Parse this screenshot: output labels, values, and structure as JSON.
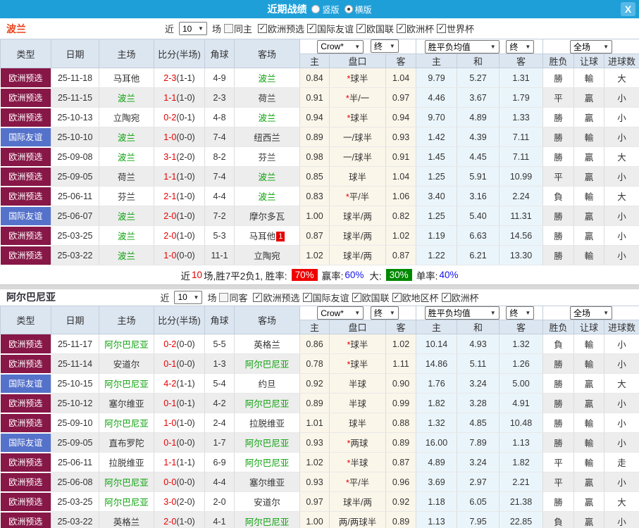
{
  "titlebar": {
    "title": "近期战绩",
    "vertical_label": "竖版",
    "horizontal_label": "横版",
    "horizontal_checked": true,
    "close_label": "X"
  },
  "colors": {
    "titlebar_blue": "#1f9fd8",
    "qualifier_maroon": "#871747",
    "friendly_blue": "#5572cb",
    "team_link_green": "#0aa10a",
    "score_red": "#e60000",
    "win_rate_badge_red": "#ee0000",
    "big_rate_badge_green": "#008800",
    "handicap_col_cream": "#fbf6ea",
    "avg_col_blue": "#eaf5fb"
  },
  "table_header": {
    "type": "类型",
    "date": "日期",
    "home": "主场",
    "score": "比分(半场)",
    "corner": "角球",
    "away": "客场",
    "odds_select": "Crow*",
    "odds_final": "终",
    "odds_home": "主",
    "odds_handicap": "盘口",
    "odds_away": "客",
    "avg_select": "胜平负均值",
    "avg_final": "终",
    "avg_home": "主",
    "avg_draw": "和",
    "avg_away": "客",
    "full_select": "全场",
    "res_col": "胜负",
    "let_col": "让球",
    "goal_col": "进球数"
  },
  "sections": [
    {
      "team": "波兰",
      "near_label": "近",
      "count": "10",
      "unit_label": "场",
      "same_label": "同主",
      "same_checked": false,
      "filters": [
        {
          "label": "欧洲预选",
          "checked": true
        },
        {
          "label": "国际友谊",
          "checked": true
        },
        {
          "label": "欧国联",
          "checked": true
        },
        {
          "label": "欧洲杯",
          "checked": true
        },
        {
          "label": "世界杯",
          "checked": true
        }
      ],
      "rows": [
        {
          "comp": "欧洲预选",
          "friendly": false,
          "date": "25-11-18",
          "home": "马耳他",
          "homeActive": false,
          "homeBadge": "",
          "score": "2-3",
          "half": "(1-1)",
          "corner": "4-9",
          "away": "波兰",
          "awayActive": true,
          "awayBadge": "",
          "h": "0.84",
          "star": true,
          "hc": "球半",
          "a": "1.04",
          "m1": "9.79",
          "m2": "5.27",
          "m3": "1.31",
          "r": "勝",
          "hr": "輸",
          "g": "大"
        },
        {
          "comp": "欧洲预选",
          "friendly": false,
          "date": "25-11-15",
          "home": "波兰",
          "homeActive": true,
          "homeBadge": "",
          "score": "1-1",
          "half": "(1-0)",
          "corner": "2-3",
          "away": "荷兰",
          "awayActive": false,
          "awayBadge": "",
          "h": "0.91",
          "star": true,
          "hc": "半/一",
          "a": "0.97",
          "m1": "4.46",
          "m2": "3.67",
          "m3": "1.79",
          "r": "平",
          "hr": "贏",
          "g": "小"
        },
        {
          "comp": "欧洲预选",
          "friendly": false,
          "date": "25-10-13",
          "home": "立陶宛",
          "homeActive": false,
          "homeBadge": "",
          "score": "0-2",
          "half": "(0-1)",
          "corner": "4-8",
          "away": "波兰",
          "awayActive": true,
          "awayBadge": "",
          "h": "0.94",
          "star": true,
          "hc": "球半",
          "a": "0.94",
          "m1": "9.70",
          "m2": "4.89",
          "m3": "1.33",
          "r": "勝",
          "hr": "贏",
          "g": "小"
        },
        {
          "comp": "国际友谊",
          "friendly": true,
          "date": "25-10-10",
          "home": "波兰",
          "homeActive": true,
          "homeBadge": "",
          "score": "1-0",
          "half": "(0-0)",
          "corner": "7-4",
          "away": "纽西兰",
          "awayActive": false,
          "awayBadge": "",
          "h": "0.89",
          "star": false,
          "hc": "一/球半",
          "a": "0.93",
          "m1": "1.42",
          "m2": "4.39",
          "m3": "7.11",
          "r": "勝",
          "hr": "輸",
          "g": "小"
        },
        {
          "comp": "欧洲预选",
          "friendly": false,
          "date": "25-09-08",
          "home": "波兰",
          "homeActive": true,
          "homeBadge": "",
          "score": "3-1",
          "half": "(2-0)",
          "corner": "8-2",
          "away": "芬兰",
          "awayActive": false,
          "awayBadge": "",
          "h": "0.98",
          "star": false,
          "hc": "一/球半",
          "a": "0.91",
          "m1": "1.45",
          "m2": "4.45",
          "m3": "7.11",
          "r": "勝",
          "hr": "贏",
          "g": "大"
        },
        {
          "comp": "欧洲预选",
          "friendly": false,
          "date": "25-09-05",
          "home": "荷兰",
          "homeActive": false,
          "homeBadge": "",
          "score": "1-1",
          "half": "(1-0)",
          "corner": "7-4",
          "away": "波兰",
          "awayActive": true,
          "awayBadge": "",
          "h": "0.85",
          "star": false,
          "hc": "球半",
          "a": "1.04",
          "m1": "1.25",
          "m2": "5.91",
          "m3": "10.99",
          "r": "平",
          "hr": "贏",
          "g": "小"
        },
        {
          "comp": "欧洲预选",
          "friendly": false,
          "date": "25-06-11",
          "home": "芬兰",
          "homeActive": false,
          "homeBadge": "",
          "score": "2-1",
          "half": "(1-0)",
          "corner": "4-4",
          "away": "波兰",
          "awayActive": true,
          "awayBadge": "",
          "h": "0.83",
          "star": true,
          "hc": "平/半",
          "a": "1.06",
          "m1": "3.40",
          "m2": "3.16",
          "m3": "2.24",
          "r": "負",
          "hr": "輸",
          "g": "大"
        },
        {
          "comp": "国际友谊",
          "friendly": true,
          "date": "25-06-07",
          "home": "波兰",
          "homeActive": true,
          "homeBadge": "",
          "score": "2-0",
          "half": "(1-0)",
          "corner": "7-2",
          "away": "摩尔多瓦",
          "awayActive": false,
          "awayBadge": "",
          "h": "1.00",
          "star": false,
          "hc": "球半/两",
          "a": "0.82",
          "m1": "1.25",
          "m2": "5.40",
          "m3": "11.31",
          "r": "勝",
          "hr": "贏",
          "g": "小"
        },
        {
          "comp": "欧洲预选",
          "friendly": false,
          "date": "25-03-25",
          "home": "波兰",
          "homeActive": true,
          "homeBadge": "",
          "score": "2-0",
          "half": "(1-0)",
          "corner": "5-3",
          "away": "马耳他",
          "awayActive": false,
          "awayBadge": "1",
          "h": "0.87",
          "star": false,
          "hc": "球半/两",
          "a": "1.02",
          "m1": "1.19",
          "m2": "6.63",
          "m3": "14.56",
          "r": "勝",
          "hr": "贏",
          "g": "小"
        },
        {
          "comp": "欧洲预选",
          "friendly": false,
          "date": "25-03-22",
          "home": "波兰",
          "homeActive": true,
          "homeBadge": "",
          "score": "1-0",
          "half": "(0-0)",
          "corner": "11-1",
          "away": "立陶宛",
          "awayActive": false,
          "awayBadge": "",
          "h": "1.02",
          "star": false,
          "hc": "球半/两",
          "a": "0.87",
          "m1": "1.22",
          "m2": "6.21",
          "m3": "13.30",
          "r": "勝",
          "hr": "輸",
          "g": "小"
        }
      ],
      "summary": {
        "near": "近",
        "count": "10",
        "mid": "场,胜7平2负1, 胜率:",
        "win_pct": "70%",
        "win_odds_label": "赢率:",
        "win_odds_pct": "60%",
        "big_label": "大:",
        "big_pct": "30%",
        "single_label": "单率:",
        "single_pct": "40%"
      }
    },
    {
      "team": "阿尔巴尼亚",
      "near_label": "近",
      "count": "10",
      "unit_label": "场",
      "same_label": "同客",
      "same_checked": false,
      "filters": [
        {
          "label": "欧洲预选",
          "checked": true
        },
        {
          "label": "国际友谊",
          "checked": true
        },
        {
          "label": "欧国联",
          "checked": true
        },
        {
          "label": "欧地区杯",
          "checked": true
        },
        {
          "label": "欧洲杯",
          "checked": true
        }
      ],
      "rows": [
        {
          "comp": "欧洲预选",
          "friendly": false,
          "date": "25-11-17",
          "home": "阿尔巴尼亚",
          "homeActive": true,
          "homeBadge": "",
          "score": "0-2",
          "half": "(0-0)",
          "corner": "5-5",
          "away": "英格兰",
          "awayActive": false,
          "awayBadge": "",
          "h": "0.86",
          "star": true,
          "hc": "球半",
          "a": "1.02",
          "m1": "10.14",
          "m2": "4.93",
          "m3": "1.32",
          "r": "負",
          "hr": "輸",
          "g": "小"
        },
        {
          "comp": "欧洲预选",
          "friendly": false,
          "date": "25-11-14",
          "home": "安道尔",
          "homeActive": false,
          "homeBadge": "",
          "score": "0-1",
          "half": "(0-0)",
          "corner": "1-3",
          "away": "阿尔巴尼亚",
          "awayActive": true,
          "awayBadge": "",
          "h": "0.78",
          "star": true,
          "hc": "球半",
          "a": "1.11",
          "m1": "14.86",
          "m2": "5.11",
          "m3": "1.26",
          "r": "勝",
          "hr": "輸",
          "g": "小"
        },
        {
          "comp": "国际友谊",
          "friendly": true,
          "date": "25-10-15",
          "home": "阿尔巴尼亚",
          "homeActive": true,
          "homeBadge": "",
          "score": "4-2",
          "half": "(1-1)",
          "corner": "5-4",
          "away": "约旦",
          "awayActive": false,
          "awayBadge": "",
          "h": "0.92",
          "star": false,
          "hc": "半球",
          "a": "0.90",
          "m1": "1.76",
          "m2": "3.24",
          "m3": "5.00",
          "r": "勝",
          "hr": "贏",
          "g": "大"
        },
        {
          "comp": "欧洲预选",
          "friendly": false,
          "date": "25-10-12",
          "home": "塞尔维亚",
          "homeActive": false,
          "homeBadge": "",
          "score": "0-1",
          "half": "(0-1)",
          "corner": "4-2",
          "away": "阿尔巴尼亚",
          "awayActive": true,
          "awayBadge": "",
          "h": "0.89",
          "star": false,
          "hc": "半球",
          "a": "0.99",
          "m1": "1.82",
          "m2": "3.28",
          "m3": "4.91",
          "r": "勝",
          "hr": "贏",
          "g": "小"
        },
        {
          "comp": "欧洲预选",
          "friendly": false,
          "date": "25-09-10",
          "home": "阿尔巴尼亚",
          "homeActive": true,
          "homeBadge": "",
          "score": "1-0",
          "half": "(1-0)",
          "corner": "2-4",
          "away": "拉脱维亚",
          "awayActive": false,
          "awayBadge": "",
          "h": "1.01",
          "star": false,
          "hc": "球半",
          "a": "0.88",
          "m1": "1.32",
          "m2": "4.85",
          "m3": "10.48",
          "r": "勝",
          "hr": "輸",
          "g": "小"
        },
        {
          "comp": "国际友谊",
          "friendly": true,
          "date": "25-09-05",
          "home": "直布罗陀",
          "homeActive": false,
          "homeBadge": "",
          "score": "0-1",
          "half": "(0-0)",
          "corner": "1-7",
          "away": "阿尔巴尼亚",
          "awayActive": true,
          "awayBadge": "",
          "h": "0.93",
          "star": true,
          "hc": "两球",
          "a": "0.89",
          "m1": "16.00",
          "m2": "7.89",
          "m3": "1.13",
          "r": "勝",
          "hr": "輸",
          "g": "小"
        },
        {
          "comp": "欧洲预选",
          "friendly": false,
          "date": "25-06-11",
          "home": "拉脱维亚",
          "homeActive": false,
          "homeBadge": "",
          "score": "1-1",
          "half": "(1-1)",
          "corner": "6-9",
          "away": "阿尔巴尼亚",
          "awayActive": true,
          "awayBadge": "",
          "h": "1.02",
          "star": true,
          "hc": "半球",
          "a": "0.87",
          "m1": "4.89",
          "m2": "3.24",
          "m3": "1.82",
          "r": "平",
          "hr": "輸",
          "g": "走"
        },
        {
          "comp": "欧洲预选",
          "friendly": false,
          "date": "25-06-08",
          "home": "阿尔巴尼亚",
          "homeActive": true,
          "homeBadge": "",
          "score": "0-0",
          "half": "(0-0)",
          "corner": "4-4",
          "away": "塞尔维亚",
          "awayActive": false,
          "awayBadge": "",
          "h": "0.93",
          "star": true,
          "hc": "平/半",
          "a": "0.96",
          "m1": "3.69",
          "m2": "2.97",
          "m3": "2.21",
          "r": "平",
          "hr": "贏",
          "g": "小"
        },
        {
          "comp": "欧洲预选",
          "friendly": false,
          "date": "25-03-25",
          "home": "阿尔巴尼亚",
          "homeActive": true,
          "homeBadge": "",
          "score": "3-0",
          "half": "(2-0)",
          "corner": "2-0",
          "away": "安道尔",
          "awayActive": false,
          "awayBadge": "",
          "h": "0.97",
          "star": false,
          "hc": "球半/两",
          "a": "0.92",
          "m1": "1.18",
          "m2": "6.05",
          "m3": "21.38",
          "r": "勝",
          "hr": "贏",
          "g": "大"
        },
        {
          "comp": "欧洲预选",
          "friendly": false,
          "date": "25-03-22",
          "home": "英格兰",
          "homeActive": false,
          "homeBadge": "",
          "score": "2-0",
          "half": "(1-0)",
          "corner": "4-1",
          "away": "阿尔巴尼亚",
          "awayActive": true,
          "awayBadge": "",
          "h": "1.00",
          "star": false,
          "hc": "两/两球半",
          "a": "0.89",
          "m1": "1.13",
          "m2": "7.95",
          "m3": "22.85",
          "r": "負",
          "hr": "贏",
          "g": "小"
        }
      ]
    }
  ]
}
